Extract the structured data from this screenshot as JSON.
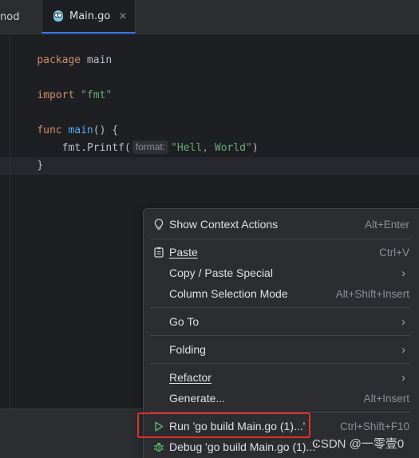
{
  "tabs": [
    {
      "label": "nod"
    },
    {
      "label": "Main.go",
      "close": "×"
    }
  ],
  "code": {
    "line1": {
      "kw": "package",
      "rest": " main"
    },
    "line3": {
      "kw": "import",
      "str": "\"fmt\""
    },
    "line5": {
      "kw": "func",
      "fn": "main",
      "rest": "() {"
    },
    "line6": {
      "pre": "fmt.",
      "fn": "Printf",
      "open": "(",
      "hint": "format:",
      "str": "\"Hell, World\"",
      "close": ")"
    },
    "line7": {
      "text": "}"
    }
  },
  "menu": {
    "items": [
      {
        "label": "Show Context Actions",
        "shortcut": "Alt+Enter",
        "icon": "bulb-icon"
      },
      {
        "label": "Paste",
        "shortcut": "Ctrl+V",
        "icon": "clipboard-icon"
      },
      {
        "label": "Copy / Paste Special",
        "arrow": "›"
      },
      {
        "label": "Column Selection Mode",
        "shortcut": "Alt+Shift+Insert"
      },
      {
        "label": "Go To",
        "arrow": "›"
      },
      {
        "label": "Folding",
        "arrow": "›"
      },
      {
        "label": "Refactor",
        "arrow": "›"
      },
      {
        "label": "Generate...",
        "shortcut": "Alt+Insert"
      },
      {
        "label": "Run 'go build Main.go (1)...'",
        "shortcut": "Ctrl+Shift+F10",
        "icon": "run-icon"
      },
      {
        "label": "Debug 'go build Main.go (1)...'",
        "icon": "debug-icon"
      }
    ]
  },
  "watermark": "CSDN @一零壹0",
  "colors": {
    "highlight_box": "#e0302a",
    "run_icon": "#5fb865",
    "keyword": "#cf8e6d",
    "function": "#56a8f5",
    "string": "#6aab73"
  }
}
